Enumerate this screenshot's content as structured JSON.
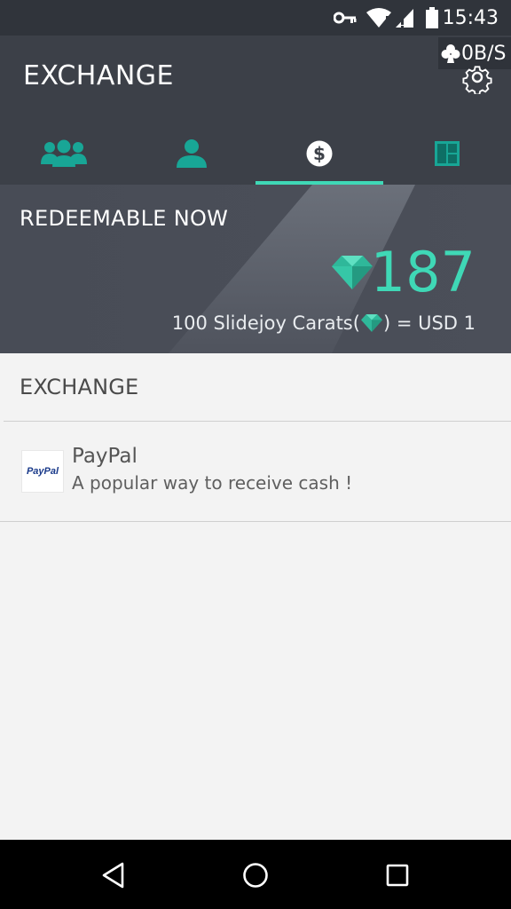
{
  "status_bar": {
    "time": "15:43",
    "icons": [
      "key-icon",
      "wifi-icon",
      "signal-icon",
      "battery-icon"
    ]
  },
  "app_bar": {
    "title": "EXCHANGE",
    "net_speed": "0B/S",
    "tabs": [
      {
        "name": "group",
        "icon": "people-icon"
      },
      {
        "name": "profile",
        "icon": "person-icon"
      },
      {
        "name": "exchange",
        "icon": "dollar-icon",
        "active": true
      },
      {
        "name": "lockscreen",
        "icon": "grid-icon"
      }
    ],
    "accent_color": "#3fd8b6"
  },
  "banner": {
    "label": "REDEEMABLE NOW",
    "amount": "187",
    "rate_prefix": "100 Slidejoy Carats(",
    "rate_suffix": ") = USD 1"
  },
  "exchange_section": {
    "title": "EXCHANGE",
    "options": [
      {
        "logo_text": "PayPal",
        "name": "PayPal",
        "description": "A popular way to receive cash !"
      }
    ]
  }
}
